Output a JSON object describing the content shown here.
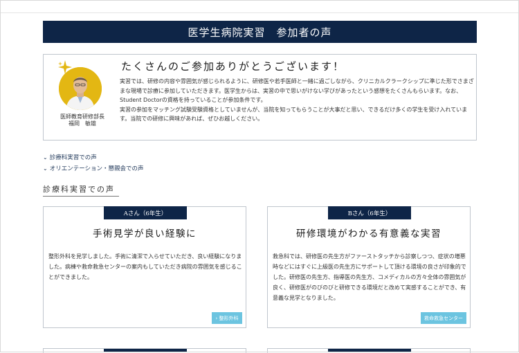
{
  "header": {
    "title": "医学生病院実習　参加者の声"
  },
  "greeting": {
    "heading": "たくさんのご参加ありがとうございます！",
    "doctor_title": "医師教育研修部長",
    "doctor_name": "福岡　敏雄",
    "paragraph1": "実習では、研修の内容や雰囲気が感じられるように、研修医や若手医師と一緒に過ごしながら、クリニカルクラークシップに準じた形でさまざまな現場で診療に参加していただきます。医学生からは、実習の中で思いがけない学びがあったという感想をたくさんもらいます。なお、Student Doctorの資格を持っていることが参加条件です。",
    "paragraph2": "実習の参加をマッチング試験受験資格としていませんが、当院を知ってもらうことが大事だと思い、できるだけ多くの学生を受け入れています。当院での研修に興味があれば、ぜひお越しください。"
  },
  "links": [
    {
      "label": "診療科実習での声"
    },
    {
      "label": "オリエンテーション・懇親会での声"
    }
  ],
  "section": {
    "heading": "診療科実習での声"
  },
  "cards": [
    {
      "tab": "Aさん（6年生）",
      "title": "手術見学が良い経験に",
      "body": "整形外科を見学しました。手術に清潔で入らせていただき、良い経験になりました。病棟や救命救急センターの案内もしていただき病院の雰囲気を感じることができました。",
      "button": "› 整形外科"
    },
    {
      "tab": "Bさん（6年生）",
      "title": "研修環境がわかる有意義な実習",
      "body": "救急科では、研修医の先生方がファーストタッチから診察しつつ、症状の増悪時などにはすぐに上級医の先生方にサポートして頂ける環境の良さが印象的でした。研修医の先生方、指導医の先生方、コメディカルの方々全体の雰囲気が良く、研修医がのびのびと研修できる環境だと改めて実感することができ、有意義な見学となりました。",
      "button": "救命救急センター"
    }
  ],
  "colors": {
    "navy": "#0e2547",
    "accent_button": "#6cc4e0",
    "portrait_bg": "#e3b713"
  }
}
